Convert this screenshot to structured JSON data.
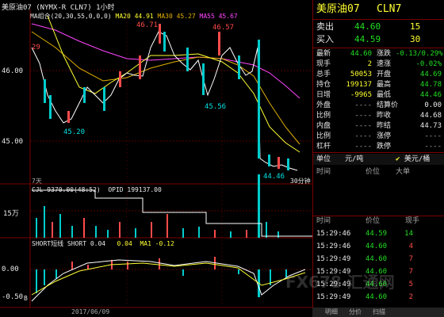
{
  "window": {
    "title": "美原油07 (NYMX-R CLN7) 1小时"
  },
  "main_chart": {
    "ma_legend": {
      "label": "MA组合(20,30,55,0,0,0)",
      "ma20": "MA20 44.91",
      "ma30": "MA30 45.27",
      "ma55": "MA55 45.67"
    },
    "price_labels": [
      "46.00",
      "45.00"
    ],
    "left_marker": "29",
    "annotations": [
      "46.71",
      "46.57",
      "45.20",
      "45.56",
      "44.46"
    ],
    "bottom_left": "7天",
    "bottom_right": "30分钟"
  },
  "volume_chart": {
    "legend": {
      "cjl": "CJL  9370.00(48:52)",
      "opid": "OPID  199137.00"
    },
    "y_label": "15万"
  },
  "short_chart": {
    "legend": {
      "name": "SHORT短线",
      "short": "SHORT  0.04",
      "short_val": "0.04",
      "ma1": "MA1  -0.12"
    },
    "y_labels": [
      "0.00",
      "-0.50"
    ],
    "date_label": "2017/06/09",
    "marker": "B"
  },
  "quote": {
    "name": "美原油07",
    "code": "CLN7",
    "sell": {
      "label": "卖出",
      "price": "44.60",
      "vol": "15"
    },
    "buy": {
      "label": "买入",
      "price": "44.59",
      "vol": "30"
    },
    "fields": [
      {
        "l1": "最新",
        "v1": "44.60",
        "c1": "g",
        "l2": "涨跌",
        "v2": "-0.13/0.29%",
        "c2": "g"
      },
      {
        "l1": "现手",
        "v1": "2",
        "c1": "y",
        "l2": "速涨",
        "v2": "-0.02%",
        "c2": "g"
      },
      {
        "l1": "总手",
        "v1": "50053",
        "c1": "y",
        "l2": "开盘",
        "v2": "44.69",
        "c2": "g"
      },
      {
        "l1": "持仓",
        "v1": "199137",
        "c1": "y",
        "l2": "最高",
        "v2": "44.78",
        "c2": "g"
      },
      {
        "l1": "日增",
        "v1": "-9965",
        "c1": "y",
        "l2": "最低",
        "v2": "44.46",
        "c2": "g"
      },
      {
        "l1": "外盘",
        "v1": "----",
        "c1": "gr",
        "l2": "结算价",
        "v2": "0.00",
        "c2": "w"
      },
      {
        "l1": "比例",
        "v1": "----",
        "c1": "gr",
        "l2": "昨收",
        "v2": "44.68",
        "c2": "w"
      },
      {
        "l1": "内盘",
        "v1": "----",
        "c1": "gr",
        "l2": "昨结",
        "v2": "44.73",
        "c2": "w"
      },
      {
        "l1": "比例",
        "v1": "----",
        "c1": "gr",
        "l2": "涨停",
        "v2": "----",
        "c2": "gr"
      },
      {
        "l1": "杠杆",
        "v1": "----",
        "c1": "gr",
        "l2": "跌停",
        "v2": "----",
        "c2": "gr"
      }
    ],
    "unit": {
      "label": "单位",
      "value": "元/吨",
      "value2": "美元/桶"
    },
    "ticks_header": {
      "time": "时间",
      "price": "价位",
      "big": "大单"
    },
    "ticks2_header": {
      "time": "时间",
      "price": "价位",
      "vol": "现手"
    },
    "ticks": [
      {
        "time": "15:29:46",
        "price": "44.59",
        "vol": "14",
        "vc": "g"
      },
      {
        "time": "15:29:46",
        "price": "44.60",
        "vol": "4",
        "vc": "r"
      },
      {
        "time": "15:29:49",
        "price": "44.60",
        "vol": "7",
        "vc": "r"
      },
      {
        "time": "15:29:49",
        "price": "44.60",
        "vol": "7",
        "vc": "r"
      },
      {
        "time": "15:29:49",
        "price": "44.60",
        "vol": "5",
        "vc": "r"
      },
      {
        "time": "15:29:49",
        "price": "44.60",
        "vol": "2",
        "vc": "r"
      }
    ],
    "tabs": [
      "明细",
      "分价",
      "扫描"
    ]
  },
  "watermark": "FX678 汇通网"
}
